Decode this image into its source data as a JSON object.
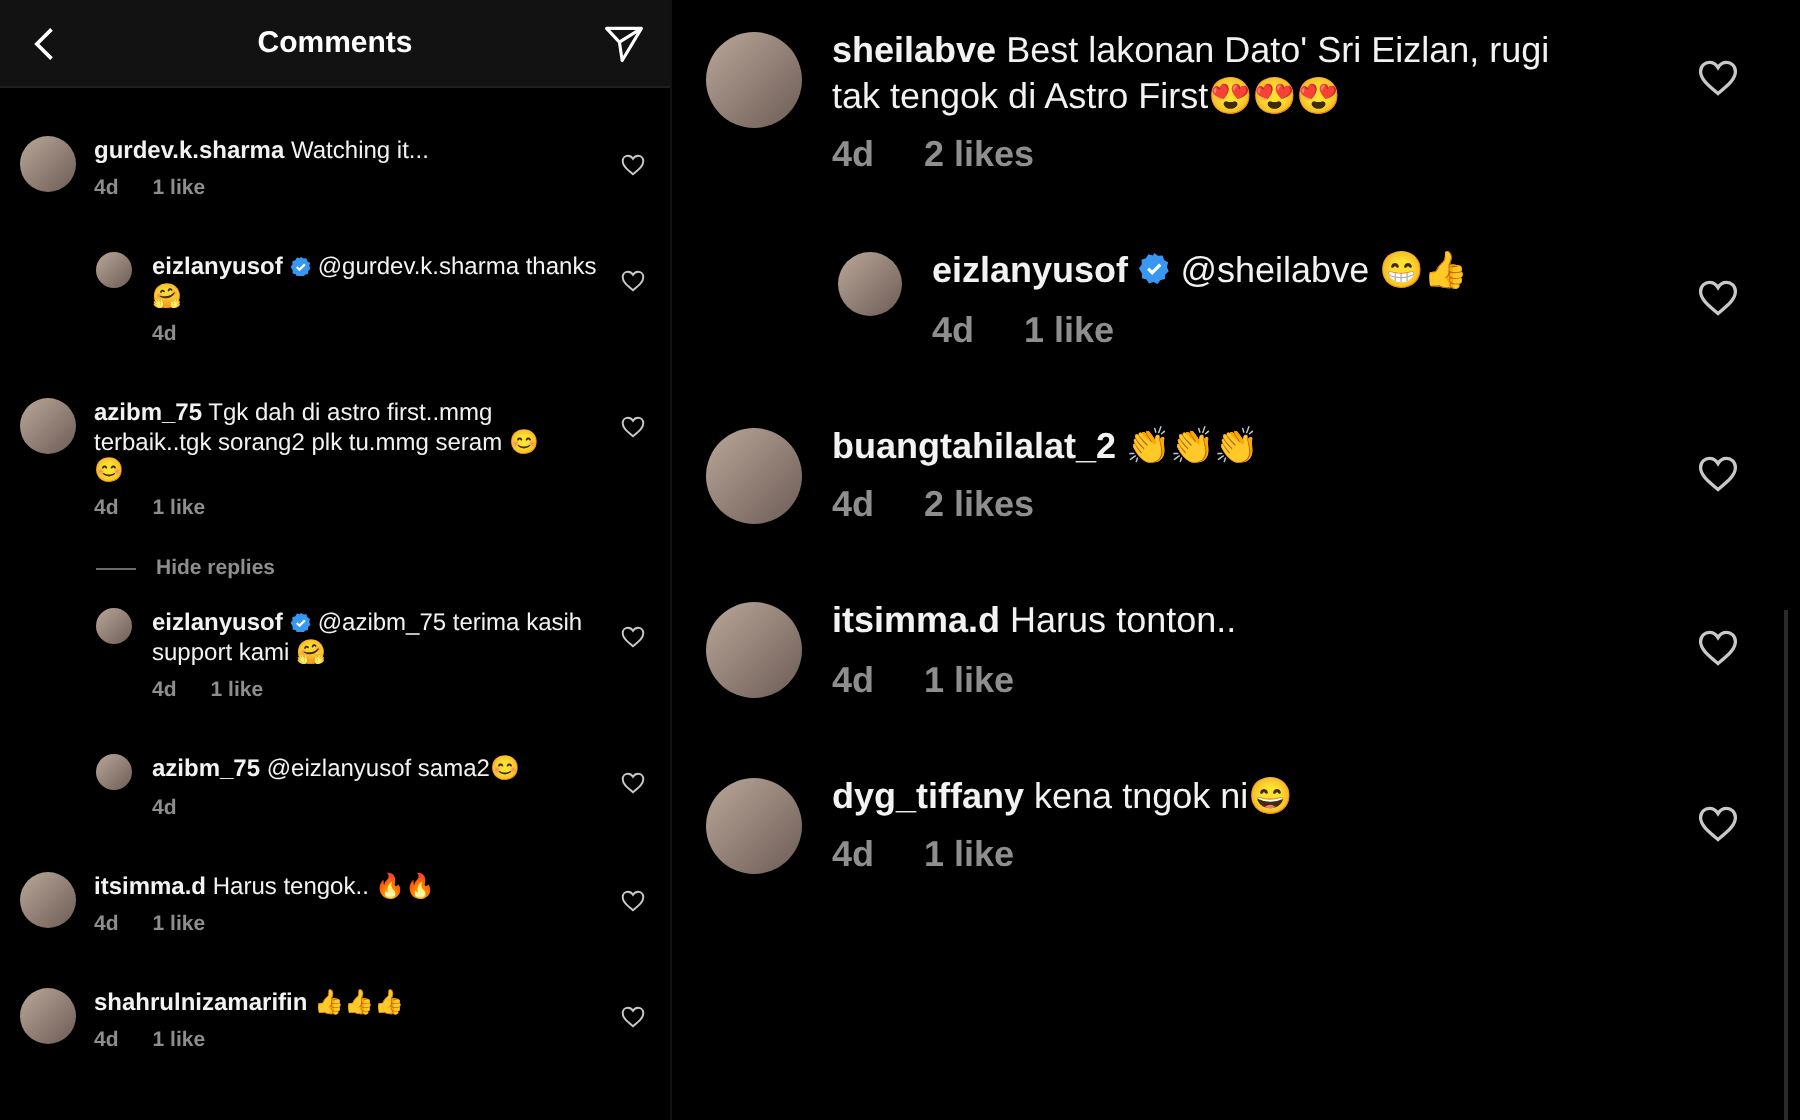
{
  "left_panel": {
    "header": {
      "title": "Comments"
    },
    "comments": [
      {
        "username": "gurdev.k.sharma",
        "verified": false,
        "text": "Watching it...",
        "time": "4d",
        "likes": "1 like",
        "replies": [
          {
            "username": "eizlanyusof",
            "verified": true,
            "text": "@gurdev.k.sharma thanks 🤗",
            "time": "4d"
          }
        ]
      },
      {
        "username": "azibm_75",
        "verified": false,
        "text": "Tgk dah di astro first..mmg terbaik..tgk sorang2 plk tu.mmg seram 😊😊",
        "time": "4d",
        "likes": "1 like",
        "replies_toggle": "Hide replies",
        "replies": [
          {
            "username": "eizlanyusof",
            "verified": true,
            "text": "@azibm_75 terima kasih support kami 🤗",
            "time": "4d",
            "likes": "1 like"
          },
          {
            "username": "azibm_75",
            "verified": false,
            "text": "@eizlanyusof sama2😊",
            "time": "4d"
          }
        ]
      },
      {
        "username": "itsimma.d",
        "verified": false,
        "text": "Harus tengok.. 🔥🔥",
        "time": "4d",
        "likes": "1 like"
      },
      {
        "username": "shahrulnizamarifin",
        "verified": false,
        "text": "👍👍👍",
        "time": "4d",
        "likes": "1 like"
      }
    ]
  },
  "right_panel": {
    "comments": [
      {
        "username": "sheilabve",
        "verified": false,
        "text": "Best lakonan Dato' Sri Eizlan, rugi tak tengok di Astro First😍😍😍",
        "time": "4d",
        "likes": "2 likes",
        "replies": [
          {
            "username": "eizlanyusof",
            "verified": true,
            "text": "@sheilabve 😁👍",
            "time": "4d",
            "likes": "1 like"
          }
        ]
      },
      {
        "username": "buangtahilalat_2",
        "verified": false,
        "text": "👏👏👏",
        "time": "4d",
        "likes": "2 likes"
      },
      {
        "username": "itsimma.d",
        "verified": false,
        "text": "Harus tonton..",
        "time": "4d",
        "likes": "1 like"
      },
      {
        "username": "dyg_tiffany",
        "verified": false,
        "text": "kena tngok ni😄",
        "time": "4d",
        "likes": "1 like"
      }
    ]
  }
}
